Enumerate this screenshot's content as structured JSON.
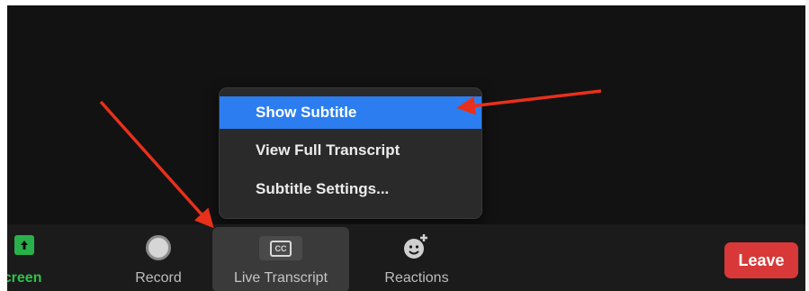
{
  "menu": {
    "items": [
      {
        "label": "Show Subtitle",
        "selected": true
      },
      {
        "label": "View Full Transcript",
        "selected": false
      },
      {
        "label": "Subtitle Settings...",
        "selected": false
      }
    ]
  },
  "toolbar": {
    "share_screen_label": "re Screen",
    "record_label": "Record",
    "live_transcript_label": "Live Transcript",
    "cc_icon_text": "CC",
    "reactions_label": "Reactions",
    "leave_label": "Leave"
  },
  "icons": {
    "share": "share-screen-icon",
    "record": "record-icon",
    "cc": "closed-caption-icon",
    "reactions": "reaction-emoji-icon"
  },
  "colors": {
    "menu_highlight": "#2c7ef0",
    "share_green": "#2fc14e",
    "leave_red": "#d93838",
    "annotation_arrow": "#e8301c"
  }
}
